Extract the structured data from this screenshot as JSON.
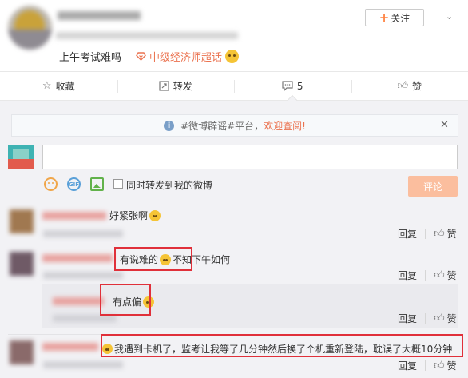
{
  "post": {
    "follow_label": "关注",
    "follow_plus": "+",
    "chevron": "⌄",
    "text": "上午考试难吗",
    "topic_label": "中级经济师超话"
  },
  "actions": {
    "collect_label": "收藏",
    "repost_label": "转发",
    "comment_count": "5",
    "like_label": "赞"
  },
  "notice": {
    "info_glyph": "i",
    "text": "#微博辟谣#平台，",
    "link": "欢迎查阅!",
    "close": "✕"
  },
  "composer": {
    "input_value": "",
    "gif_label": "GIF",
    "checkbox_label": "同时转发到我的微博",
    "submit_label": "评论"
  },
  "comments": [
    {
      "text": "好紧张啊",
      "reply_label": "回复",
      "like_label": "赞"
    },
    {
      "text_a": "有说难的",
      "text_b": "不知下午如何",
      "reply_label": "回复",
      "like_label": "赞"
    },
    {
      "text": "有点偏",
      "reply_label": "回复",
      "like_label": "赞"
    },
    {
      "text": "我遇到卡机了，监考让我等了几分钟然后换了个机重新登陆，耽误了大概10分钟",
      "reply_label": "回复",
      "like_label": "赞"
    }
  ],
  "colors": {
    "accent": "#eb7350",
    "highlight_box": "#e0303a",
    "comment_bg": "#f2f2f5",
    "submit_disabled": "#fbbe9e"
  },
  "icons": [
    "collect-icon",
    "repost-icon",
    "comment-icon",
    "like-icon",
    "info-icon",
    "close-icon",
    "emoji-icon",
    "gif-icon",
    "picture-icon",
    "thumb-up-icon",
    "topic-icon"
  ]
}
